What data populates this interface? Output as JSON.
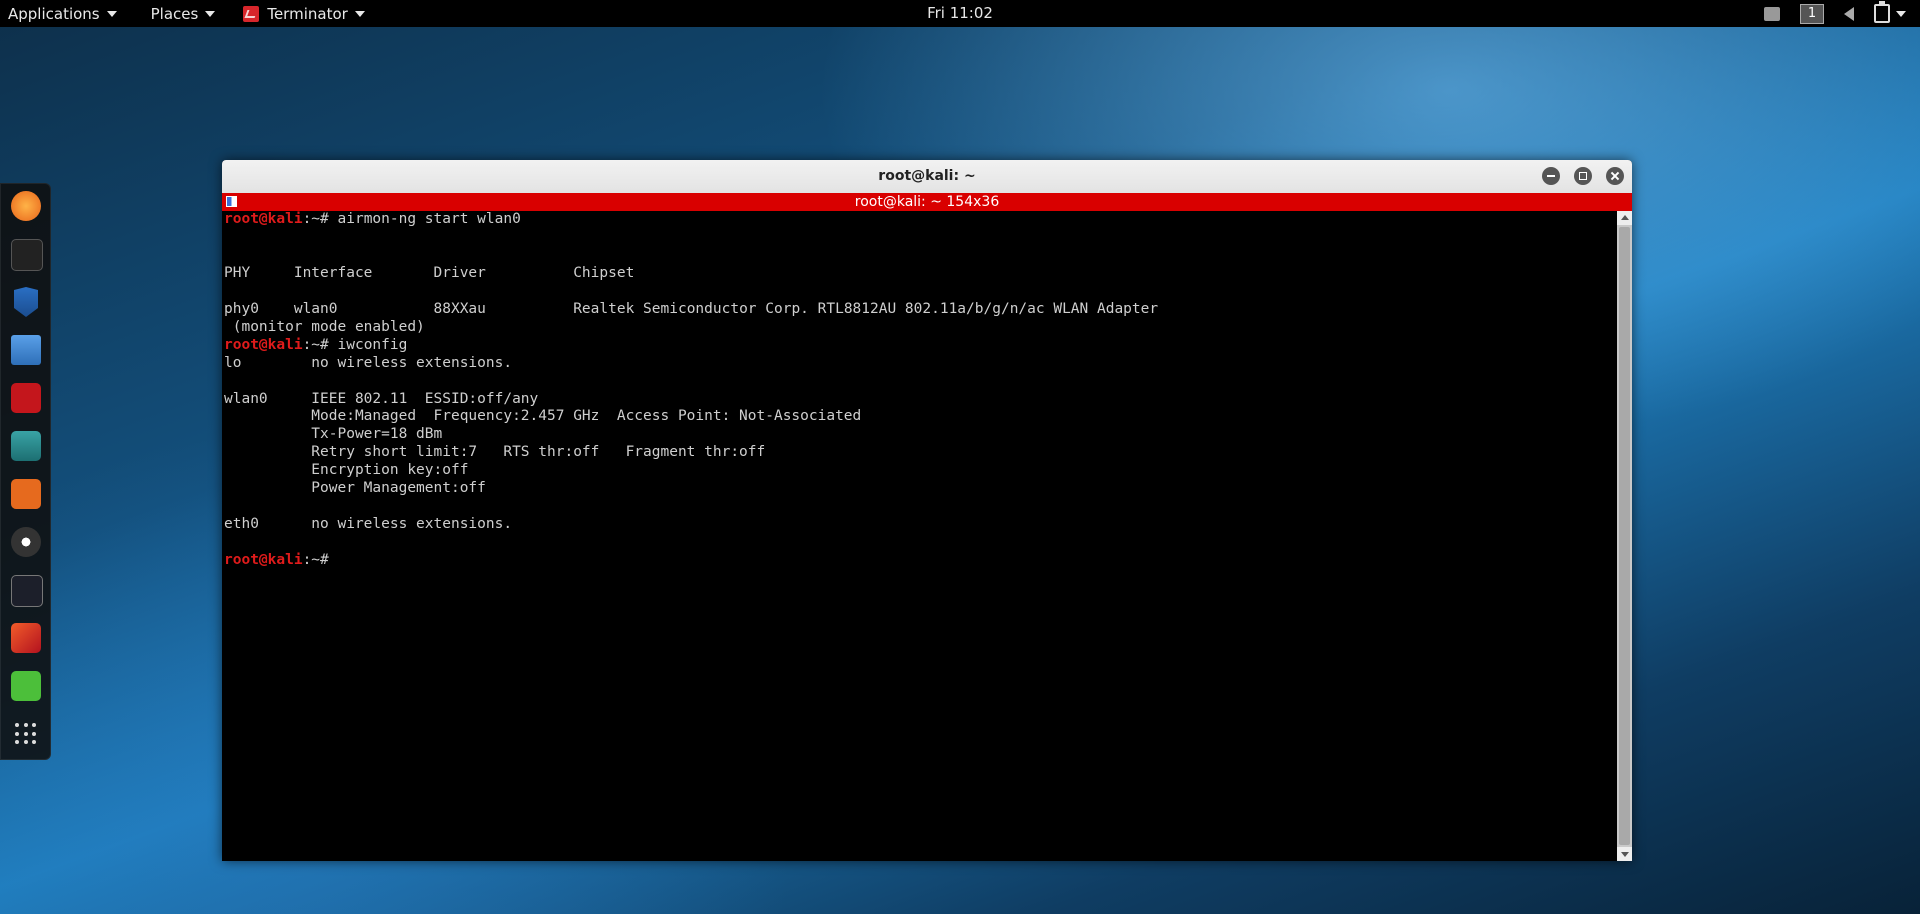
{
  "topbar": {
    "applications_label": "Applications",
    "places_label": "Places",
    "app_label": "Terminator",
    "clock": "Fri 11:02",
    "workspace_number": "1"
  },
  "dock": {
    "items": [
      {
        "icon": "firefox-icon"
      },
      {
        "icon": "terminal-icon"
      },
      {
        "icon": "metasploit-icon"
      },
      {
        "icon": "files-icon"
      },
      {
        "icon": "terminator-icon"
      },
      {
        "icon": "maltego-icon"
      },
      {
        "icon": "burpsuite-icon"
      },
      {
        "icon": "armitage-icon"
      },
      {
        "icon": "beef-icon"
      },
      {
        "icon": "faraday-icon"
      },
      {
        "icon": "leafpad-icon"
      },
      {
        "icon": "show-apps-icon"
      }
    ]
  },
  "window": {
    "title": "root@kali: ~",
    "tab_title": "root@kali: ~ 154x36"
  },
  "terminal": {
    "prompt_user": "root@kali",
    "prompt_suffix": ":~#",
    "cmd1": " airmon-ng start wlan0",
    "out1": "\n\nPHY\tInterface\tDriver\t\tChipset\n\nphy0\twlan0\t\t88XXau\t\tRealtek Semiconductor Corp. RTL8812AU 802.11a/b/g/n/ac WLAN Adapter\n (monitor mode enabled)",
    "cmd2": " iwconfig",
    "out2": "lo        no wireless extensions.\n\nwlan0     IEEE 802.11  ESSID:off/any  \n          Mode:Managed  Frequency:2.457 GHz  Access Point: Not-Associated   \n          Tx-Power=18 dBm   \n          Retry short limit:7   RTS thr:off   Fragment thr:off\n          Encryption key:off\n          Power Management:off\n          \neth0      no wireless extensions.\n",
    "cmd3": " "
  }
}
